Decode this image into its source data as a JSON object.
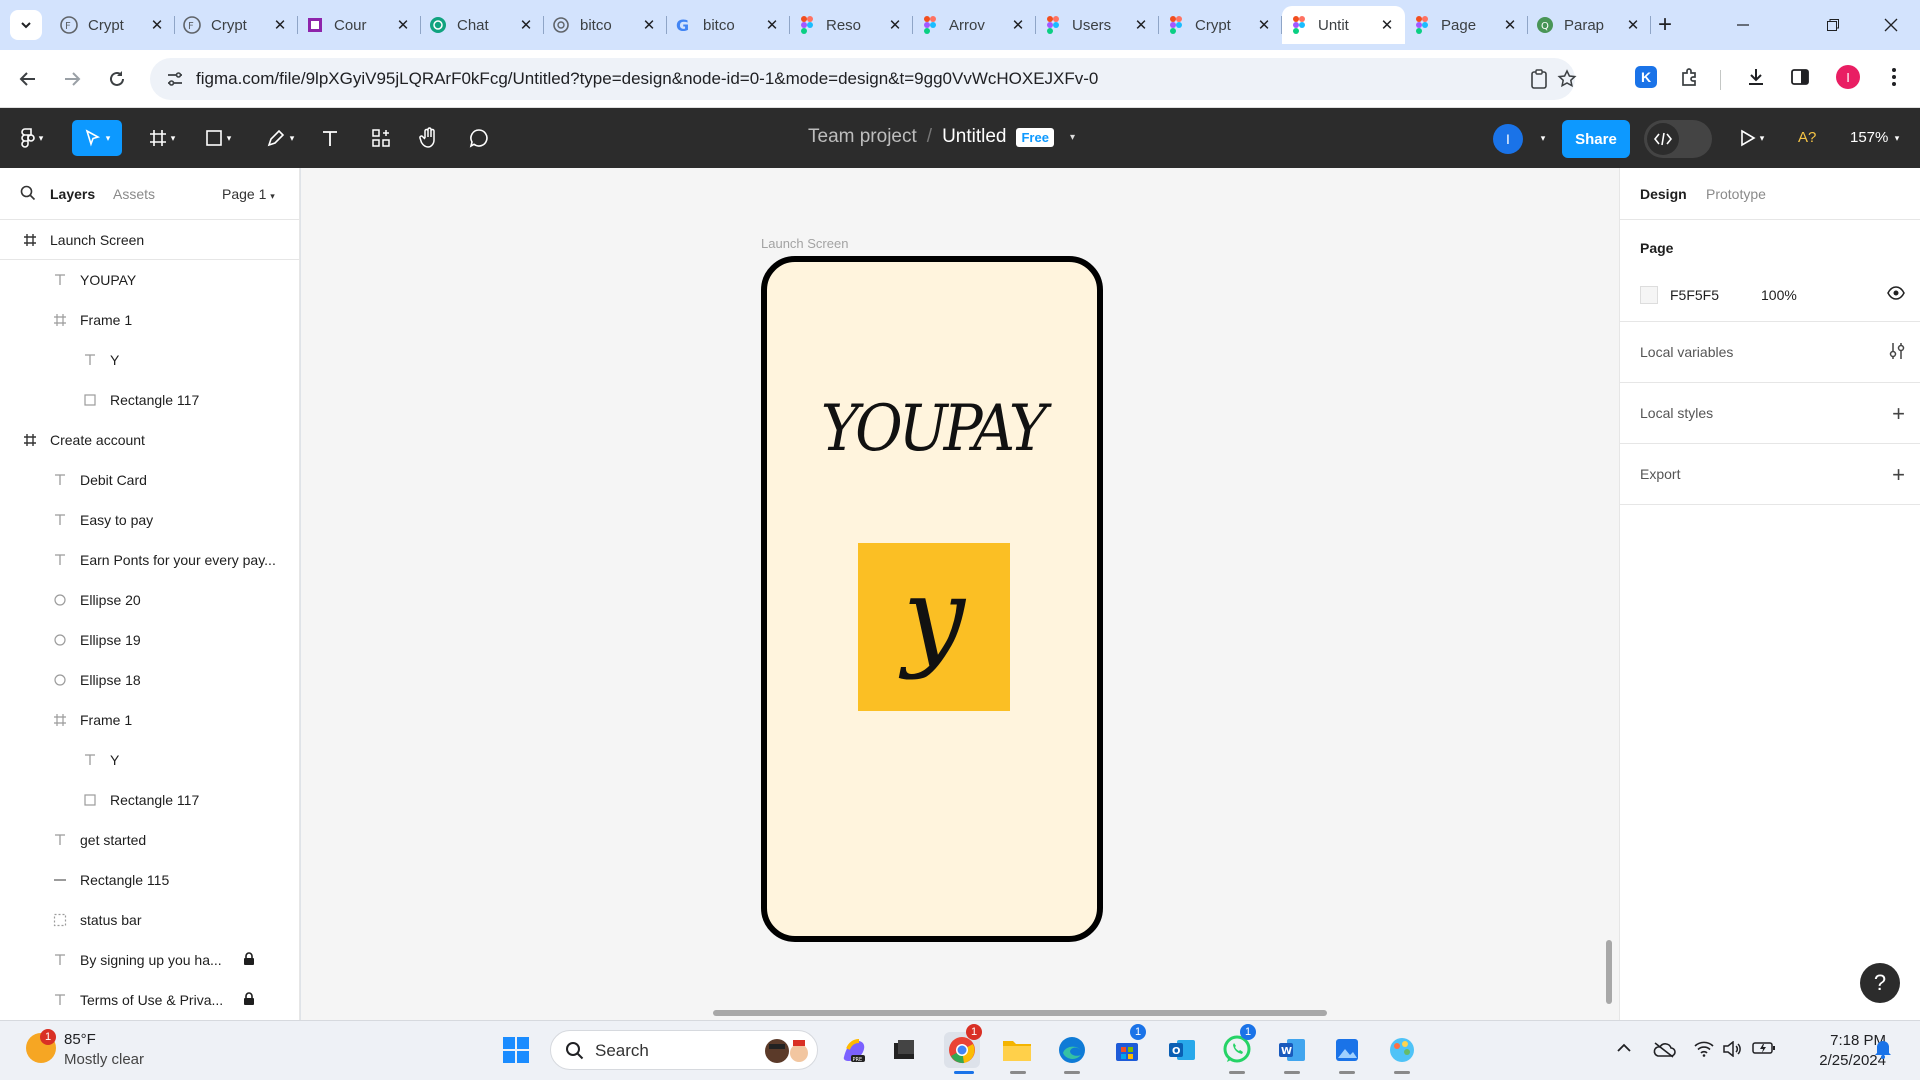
{
  "browser": {
    "tabs": [
      {
        "title": "Crypt",
        "icon": "figma-coin-icon",
        "active": false
      },
      {
        "title": "Crypt",
        "icon": "figma-coin-icon",
        "active": false
      },
      {
        "title": "Cour",
        "icon": "course-icon",
        "active": false
      },
      {
        "title": "Chat",
        "icon": "chatgpt-icon",
        "active": false
      },
      {
        "title": "bitco",
        "icon": "bitcoin-icon",
        "active": false
      },
      {
        "title": "bitco",
        "icon": "google-icon",
        "active": false
      },
      {
        "title": "Reso",
        "icon": "figma-icon",
        "active": false
      },
      {
        "title": "Arrov",
        "icon": "figma-icon",
        "active": false
      },
      {
        "title": "Users",
        "icon": "figma-icon",
        "active": false
      },
      {
        "title": "Crypt",
        "icon": "figma-icon",
        "active": false
      },
      {
        "title": "Untit",
        "icon": "figma-icon",
        "active": true
      },
      {
        "title": "Page",
        "icon": "figma-icon",
        "active": false
      },
      {
        "title": "Parap",
        "icon": "paraphrase-icon",
        "active": false
      }
    ],
    "url": "figma.com/file/9lpXGyiV95jLQRArF0kFcg/Untitled?type=design&node-id=0-1&mode=design&t=9gg0VvWcHOXEJXFv-0",
    "profile_initial": "I",
    "extension_initial": "K"
  },
  "figma": {
    "team": "Team project",
    "separator": "/",
    "file_name": "Untitled",
    "plan_badge": "Free",
    "user_initial": "I",
    "share_label": "Share",
    "ai_label": "A?",
    "zoom": "157%"
  },
  "left_panel": {
    "tab_layers": "Layers",
    "tab_assets": "Assets",
    "page_selector": "Page 1",
    "layers": [
      {
        "name": "Launch Screen",
        "type": "frame",
        "indent": 0
      },
      {
        "name": "YOUPAY",
        "type": "text",
        "indent": 1
      },
      {
        "name": "Frame 1",
        "type": "frame",
        "indent": 1
      },
      {
        "name": "Y",
        "type": "text",
        "indent": 2
      },
      {
        "name": "Rectangle 117",
        "type": "rect",
        "indent": 2
      },
      {
        "name": "Create account",
        "type": "frame",
        "indent": 0
      },
      {
        "name": "Debit Card",
        "type": "text",
        "indent": 1
      },
      {
        "name": "Easy to pay",
        "type": "text",
        "indent": 1
      },
      {
        "name": "Earn Ponts for your every pay...",
        "type": "text",
        "indent": 1
      },
      {
        "name": "Ellipse 20",
        "type": "ellipse",
        "indent": 1
      },
      {
        "name": "Ellipse 19",
        "type": "ellipse",
        "indent": 1
      },
      {
        "name": "Ellipse 18",
        "type": "ellipse",
        "indent": 1
      },
      {
        "name": "Frame 1",
        "type": "frame",
        "indent": 1
      },
      {
        "name": "Y",
        "type": "text",
        "indent": 2
      },
      {
        "name": "Rectangle 117",
        "type": "rect",
        "indent": 2
      },
      {
        "name": "get started",
        "type": "text",
        "indent": 1
      },
      {
        "name": "Rectangle 115",
        "type": "line",
        "indent": 1
      },
      {
        "name": "status bar",
        "type": "group",
        "indent": 1
      },
      {
        "name": "By signing up you ha...",
        "type": "text",
        "indent": 1,
        "locked": true
      },
      {
        "name": "Terms of Use & Priva...",
        "type": "text",
        "indent": 1,
        "locked": true
      }
    ]
  },
  "canvas": {
    "frame_label": "Launch Screen",
    "logo_text": "YOUPAY",
    "box_letter": "y",
    "colors": {
      "canvas_bg": "#f5f5f5",
      "phone_bg": "#fff4dd",
      "box": "#fbbf24"
    }
  },
  "right_panel": {
    "tab_design": "Design",
    "tab_prototype": "Prototype",
    "page_heading": "Page",
    "page_color": "F5F5F5",
    "page_opacity": "100%",
    "local_variables": "Local variables",
    "local_styles": "Local styles",
    "export": "Export",
    "help": "?"
  },
  "taskbar": {
    "weather_temp": "85°F",
    "weather_desc": "Mostly clear",
    "weather_badge": "1",
    "search_label": "Search",
    "time": "7:18 PM",
    "date": "2/25/2024",
    "badges": {
      "chrome": "1",
      "store": "1",
      "whatsapp": "1"
    }
  }
}
